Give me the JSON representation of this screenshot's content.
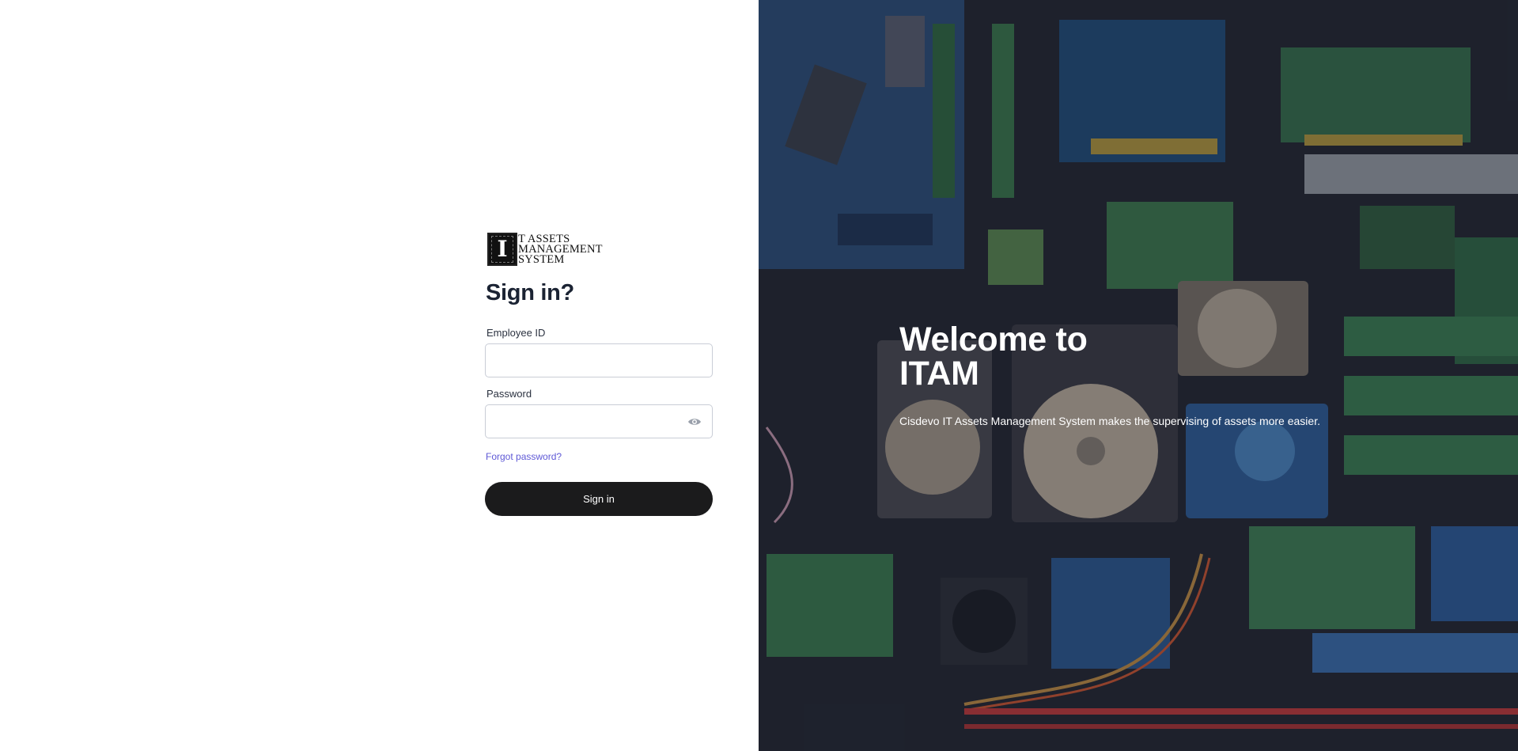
{
  "logo": {
    "mark_letter": "I",
    "line1": "T ASSETS",
    "line2": "MANAGEMENT",
    "line3": "SYSTEM"
  },
  "signin": {
    "title": "Sign in?",
    "employee_label": "Employee ID",
    "employee_value": "",
    "password_label": "Password",
    "password_value": "",
    "forgot_label": "Forgot password?",
    "button_label": "Sign in"
  },
  "hero": {
    "title_line1": "Welcome to",
    "title_line2": "ITAM",
    "subtitle": "Cisdevo IT Assets Management System makes the supervising of assets more easier."
  },
  "colors": {
    "button_bg": "#1b1b1c",
    "link": "#5f59d6",
    "title": "#1b2333"
  },
  "icons": {
    "password_toggle": "eye-icon"
  }
}
